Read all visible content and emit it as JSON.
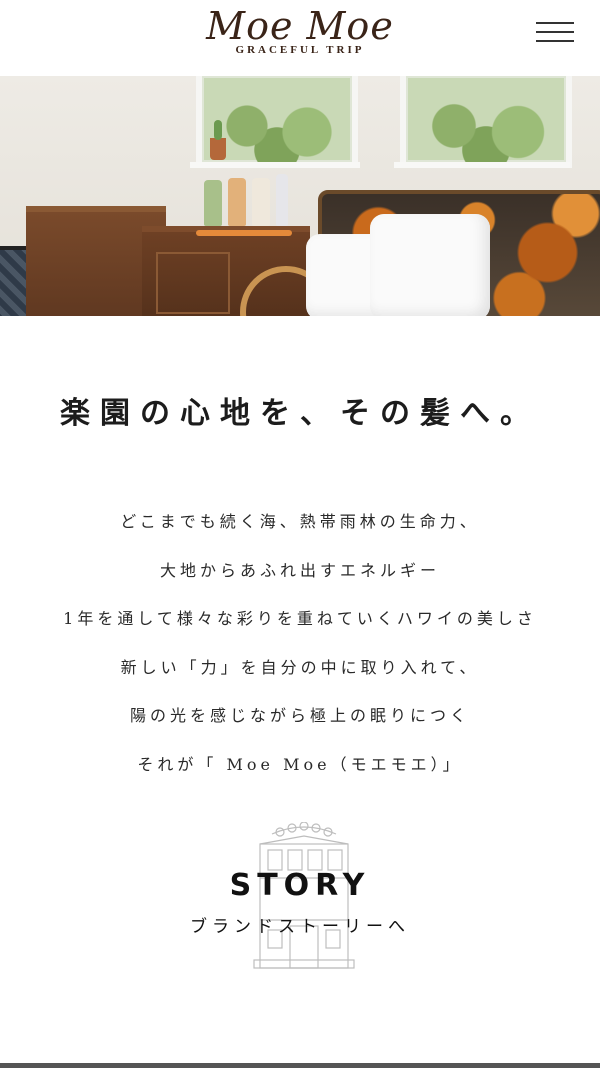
{
  "header": {
    "logo_main": "Moe Moe",
    "logo_sub": "GRACEFUL TRIP",
    "menu_icon": "hamburger-menu-icon"
  },
  "hero": {
    "image_subject": "salon interior photo"
  },
  "main": {
    "headline": "楽園の心地を、その髪へ。",
    "lines": [
      "どこまでも続く海、熱帯雨林の生命力、",
      "大地からあふれ出すエネルギー",
      "1年を通して様々な彩りを重ねていくハワイの美しさ",
      "新しい「力」を自分の中に取り入れて、",
      "陽の光を感じながら極上の眠りにつく",
      "それが「 Moe Moe（モエモエ）」"
    ]
  },
  "story": {
    "title": "STORY",
    "subtitle": "ブランドストーリーへ",
    "icon": "building-illustration-icon"
  },
  "colors": {
    "logo": "#3a2418",
    "text": "#222222",
    "background": "#ffffff"
  }
}
